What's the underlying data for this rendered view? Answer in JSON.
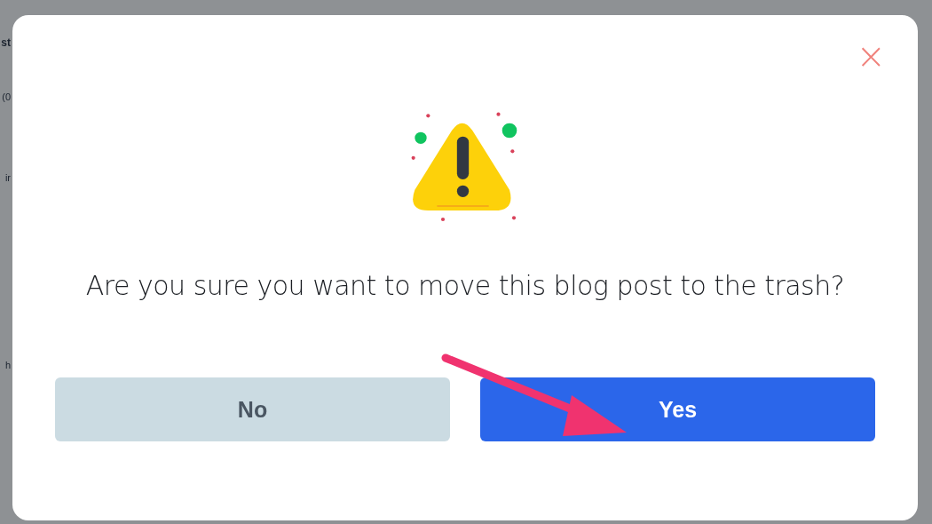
{
  "background": {
    "fragments": [
      {
        "text": "st",
        "kind": "heading"
      },
      {
        "text": "(0",
        "kind": "line"
      },
      {
        "text": "ir",
        "kind": "row"
      },
      {
        "text": "h",
        "kind": "row"
      }
    ]
  },
  "dialog": {
    "close": "×",
    "message": "Are you sure you want to move this blog post to the trash?",
    "buttons": [
      {
        "label": "No",
        "kind": "secondary"
      },
      {
        "label": "Yes",
        "kind": "primary"
      }
    ]
  }
}
